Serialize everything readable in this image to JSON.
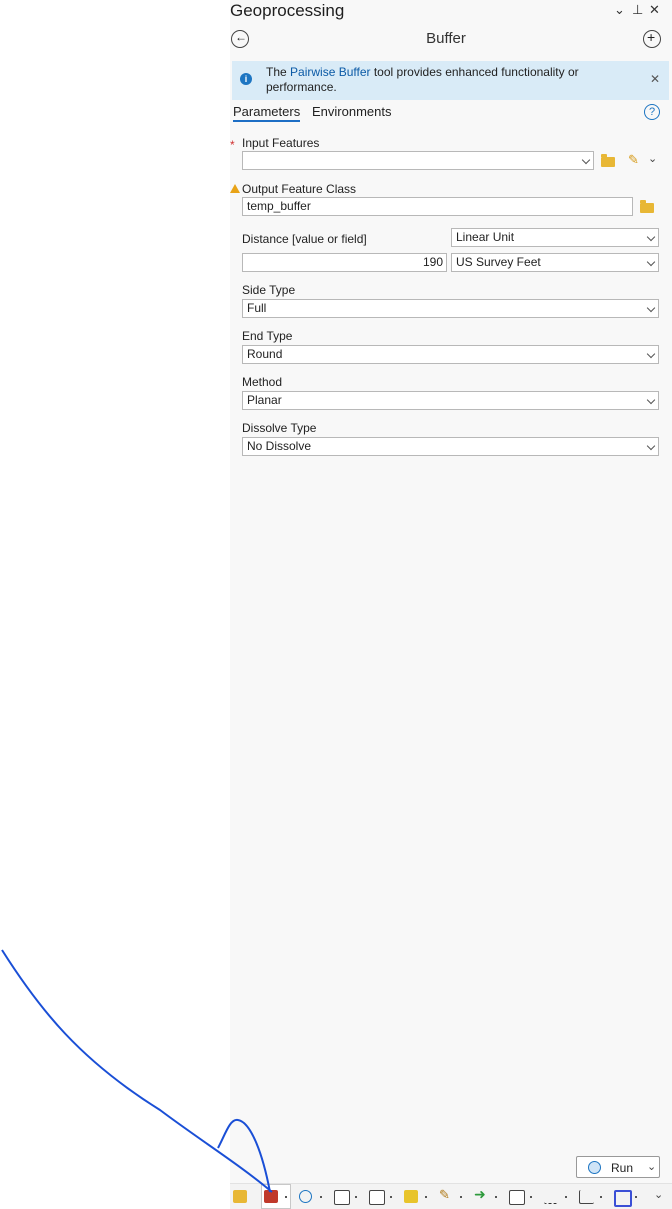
{
  "panel": {
    "title": "Geoprocessing",
    "tool_title": "Buffer",
    "controls": {
      "dropdown": "⌄",
      "pin": "📌",
      "close": "✕"
    }
  },
  "info": {
    "text_before": "The ",
    "link": "Pairwise Buffer",
    "text_after": " tool provides enhanced functionality or performance.",
    "close": "✕"
  },
  "tabs": [
    {
      "label": "Parameters",
      "active": true
    },
    {
      "label": "Environments",
      "active": false
    }
  ],
  "params": {
    "input_features": {
      "label": "Input Features",
      "value": ""
    },
    "output_class": {
      "label": "Output Feature Class",
      "value": "temp_buffer"
    },
    "distance": {
      "label": "Distance [value or field]",
      "value": "190",
      "unit_type": "Linear Unit",
      "unit": "US Survey Feet"
    },
    "side_type": {
      "label": "Side Type",
      "value": "Full"
    },
    "end_type": {
      "label": "End Type",
      "value": "Round"
    },
    "method": {
      "label": "Method",
      "value": "Planar"
    },
    "dissolve_type": {
      "label": "Dissolve Type",
      "value": "No Dissolve"
    }
  },
  "run_label": "Run",
  "taskbar_icons": [
    "catalog-icon",
    "toolbox-icon",
    "history-icon",
    "attribute-table-icon",
    "modify-icon",
    "annotation-icon",
    "edit-icon",
    "arrow-icon",
    "layout-icon",
    "vertex-icon",
    "chart-icon",
    "transform-icon"
  ],
  "colors": {
    "accent": "#1d6ec5",
    "info_bg": "#d9ebf7",
    "annotation": "#1a4fd6"
  }
}
